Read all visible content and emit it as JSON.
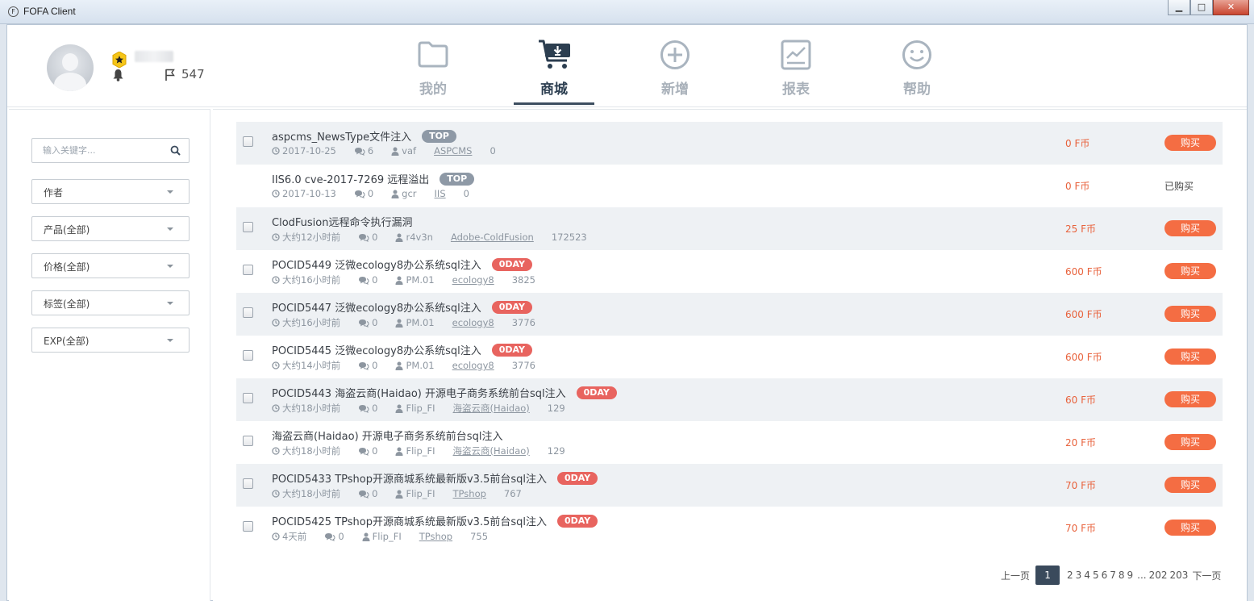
{
  "window": {
    "title": "FOFA Client",
    "controls": {
      "minimize": "▁",
      "maximize": "□",
      "close": "✕"
    }
  },
  "user": {
    "points": "547"
  },
  "nav": [
    {
      "id": "mine",
      "label": "我的",
      "icon": "folder-icon"
    },
    {
      "id": "store",
      "label": "商城",
      "icon": "cart-icon",
      "active": true
    },
    {
      "id": "add",
      "label": "新增",
      "icon": "plus-circle-icon"
    },
    {
      "id": "report",
      "label": "报表",
      "icon": "chart-icon"
    },
    {
      "id": "help",
      "label": "帮助",
      "icon": "smile-icon"
    }
  ],
  "filters": {
    "search_placeholder": "输入关键字...",
    "selects": [
      "作者",
      "产品(全部)",
      "价格(全部)",
      "标签(全部)",
      "EXP(全部)"
    ]
  },
  "items": [
    {
      "title": "aspcms_NewsType文件注入",
      "badge": "TOP",
      "time": "2017-10-25",
      "comments": "6",
      "author": "vaf",
      "product": "ASPCMS",
      "count": "0",
      "price": "0 F币",
      "action": "购买",
      "checkbox": true
    },
    {
      "title": "IIS6.0 cve-2017-7269 远程溢出",
      "badge": "TOP",
      "time": "2017-10-13",
      "comments": "0",
      "author": "gcr",
      "product": "IIS",
      "count": "0",
      "price": "0 F币",
      "action": "已购买",
      "checkbox": false
    },
    {
      "title": "ClodFusion远程命令执行漏洞",
      "badge": "",
      "time": "大约12小时前",
      "comments": "0",
      "author": "r4v3n",
      "product": "Adobe-ColdFusion",
      "count": "172523",
      "price": "25 F币",
      "action": "购买",
      "checkbox": true
    },
    {
      "title": "POCID5449 泛微ecology8办公系统sql注入",
      "badge": "0DAY",
      "time": "大约16小时前",
      "comments": "0",
      "author": "PM.01",
      "product": "ecology8",
      "count": "3825",
      "price": "600 F币",
      "action": "购买",
      "checkbox": true
    },
    {
      "title": "POCID5447 泛微ecology8办公系统sql注入",
      "badge": "0DAY",
      "time": "大约16小时前",
      "comments": "0",
      "author": "PM.01",
      "product": "ecology8",
      "count": "3776",
      "price": "600 F币",
      "action": "购买",
      "checkbox": true
    },
    {
      "title": "POCID5445 泛微ecology8办公系统sql注入",
      "badge": "0DAY",
      "time": "大约14小时前",
      "comments": "0",
      "author": "PM.01",
      "product": "ecology8",
      "count": "3776",
      "price": "600 F币",
      "action": "购买",
      "checkbox": true
    },
    {
      "title": "POCID5443 海盗云商(Haidao) 开源电子商务系统前台sql注入",
      "badge": "0DAY",
      "time": "大约18小时前",
      "comments": "0",
      "author": "Flip_FI",
      "product": "海盗云商(Haidao)",
      "count": "129",
      "price": "60 F币",
      "action": "购买",
      "checkbox": true
    },
    {
      "title": "海盗云商(Haidao) 开源电子商务系统前台sql注入",
      "badge": "",
      "time": "大约18小时前",
      "comments": "0",
      "author": "Flip_FI",
      "product": "海盗云商(Haidao)",
      "count": "129",
      "price": "20 F币",
      "action": "购买",
      "checkbox": true
    },
    {
      "title": "POCID5433 TPshop开源商城系统最新版v3.5前台sql注入",
      "badge": "0DAY",
      "time": "大约18小时前",
      "comments": "0",
      "author": "Flip_FI",
      "product": "TPshop",
      "count": "767",
      "price": "70 F币",
      "action": "购买",
      "checkbox": true
    },
    {
      "title": "POCID5425 TPshop开源商城系统最新版v3.5前台sql注入",
      "badge": "0DAY",
      "time": "4天前",
      "comments": "0",
      "author": "Flip_FI",
      "product": "TPshop",
      "count": "755",
      "price": "70 F币",
      "action": "购买",
      "checkbox": true
    }
  ],
  "pagination": {
    "prev": "上一页",
    "current": "1",
    "pages": [
      "2",
      "3",
      "4",
      "5",
      "6",
      "7",
      "8",
      "9"
    ],
    "ellipsis": "...",
    "tail": [
      "202",
      "203"
    ],
    "next": "下一页"
  },
  "colors": {
    "accent": "#f46d43",
    "price": "#e8623c",
    "nav_active": "#2c3e50",
    "badge_top": "#8e99a6",
    "badge_0day": "#e8645f"
  }
}
